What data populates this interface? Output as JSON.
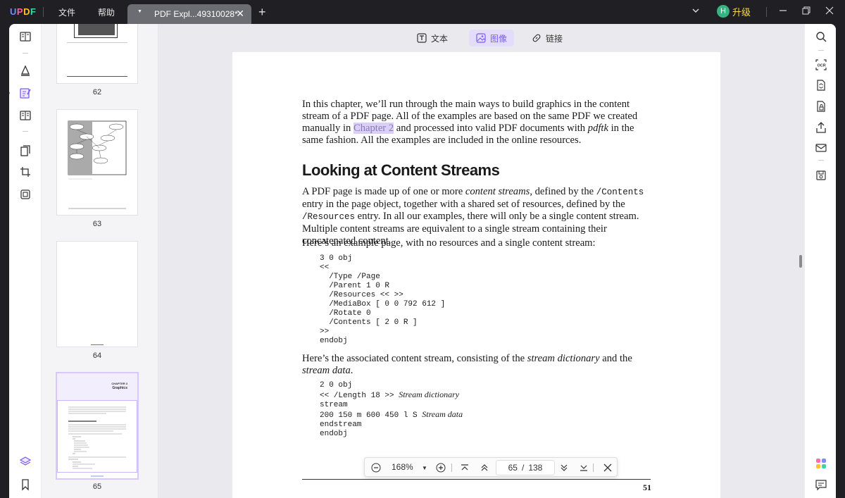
{
  "app": {
    "logo": "UPDF",
    "menu": [
      "文件",
      "帮助"
    ],
    "tab_title": "PDF Expl...49310028*",
    "avatar_letter": "H",
    "upgrade_label": "升级"
  },
  "modes": [
    {
      "label": "文本",
      "icon": "text-mode-icon"
    },
    {
      "label": "图像",
      "icon": "image-mode-icon",
      "active": true
    },
    {
      "label": "链接",
      "icon": "link-mode-icon"
    }
  ],
  "thumbnails": [
    {
      "page": "62"
    },
    {
      "page": "63"
    },
    {
      "page": "64"
    },
    {
      "page": "65",
      "active": true,
      "chapter": "CHAPTER 3",
      "chapter_title": "Graphics"
    }
  ],
  "page": {
    "intro_1": "In this chapter, we’ll run through the main ways to build graphics in the content stream of a PDF page. All of the examples are based on the same PDF we created manually in ",
    "intro_link": "Chapter 2",
    "intro_2": " and processed into valid PDF documents with ",
    "intro_tool": "pdftk",
    "intro_3": " in the same fashion. All the examples are included in the online resources.",
    "heading": "Looking at Content Streams",
    "p2_a": "A PDF page is made up of one or more ",
    "p2_b": "content streams",
    "p2_c": ", defined by the ",
    "p2_d": "/Contents",
    "p2_e": " entry in the page object, together with a shared set of resources, defined by the ",
    "p2_f": "/Resources",
    "p2_g": " entry. In all our examples, there will only be a single content stream. Multiple content streams are equivalent to a single stream containing their concatenated content.",
    "p3": "Here’s an example page, with no resources and a single content stream:",
    "code1": [
      "3 0 obj",
      "<<",
      "  /Type /Page",
      "  /Parent 1 0 R",
      "  /Resources << >>",
      "  /MediaBox [ 0 0 792 612 ]",
      "  /Rotate 0",
      "  /Contents [ 2 0 R ]",
      ">>",
      "endobj"
    ],
    "p4_a": "Here’s the associated content stream, consisting of the ",
    "p4_b": "stream dictionary",
    "p4_c": " and the ",
    "p4_d": "stream data",
    "p4_e": ".",
    "code2_l1": "2 0 obj",
    "code2_l2": "<< /Length 18 >> ",
    "code2_l2c": "Stream dictionary",
    "code2_l3": "stream",
    "code2_l4": "200 150 m 600 450 l S ",
    "code2_l4c": "Stream data",
    "code2_l5": "endstream",
    "code2_l6": "endobj",
    "page_number": "51"
  },
  "nav": {
    "zoom": "168%",
    "current_page": "65",
    "separator": "/",
    "total_pages": "138"
  }
}
